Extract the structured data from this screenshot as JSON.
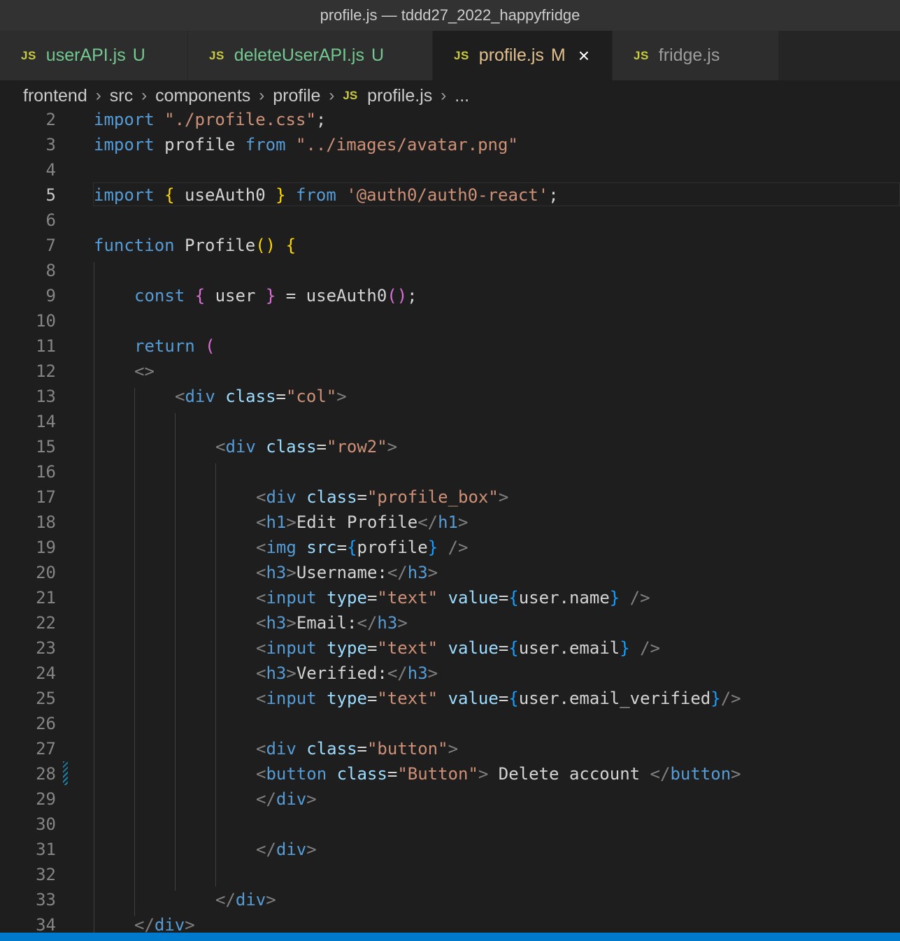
{
  "window": {
    "title": "profile.js — tddd27_2022_happyfridge"
  },
  "tabs": [
    {
      "icon": "JS",
      "name": "userAPI.js",
      "flag": "U"
    },
    {
      "icon": "JS",
      "name": "deleteUserAPI.js",
      "flag": "U"
    },
    {
      "icon": "JS",
      "name": "profile.js",
      "flag": "M",
      "close": "×"
    },
    {
      "icon": "JS",
      "name": "fridge.js",
      "flag": ""
    }
  ],
  "breadcrumb": {
    "items": [
      "frontend",
      "src",
      "components",
      "profile"
    ],
    "file_icon": "JS",
    "file": "profile.js",
    "more": "..."
  },
  "editor": {
    "line_numbers": [
      "2",
      "3",
      "4",
      "5",
      "6",
      "7",
      "8",
      "9",
      "10",
      "11",
      "12",
      "13",
      "14",
      "15",
      "16",
      "17",
      "18",
      "19",
      "20",
      "21",
      "22",
      "23",
      "24",
      "25",
      "26",
      "27",
      "28",
      "29",
      "30",
      "31",
      "32",
      "33",
      "34"
    ],
    "current_line": "5",
    "lines": {
      "l2": [
        "import",
        " ",
        "\"./profile.css\"",
        ";"
      ],
      "l3": [
        "import",
        " profile ",
        "from",
        " ",
        "\"../images/avatar.png\""
      ],
      "l5": [
        "import",
        " ",
        "{",
        " useAuth0 ",
        "}",
        " ",
        "from",
        " ",
        "'@auth0/auth0-react'",
        ";"
      ],
      "l7": [
        "function",
        " ",
        "Profile",
        "()",
        " ",
        "{"
      ],
      "l9": [
        "const",
        " ",
        "{",
        " user ",
        "}",
        " = ",
        "useAuth0",
        "()",
        ";"
      ],
      "l11": [
        "return",
        " ",
        "("
      ],
      "l12": [
        "<>"
      ],
      "l13": [
        "<",
        "div",
        " ",
        "class",
        "=",
        "\"col\"",
        ">"
      ],
      "l15": [
        "<",
        "div",
        " ",
        "class",
        "=",
        "\"row2\"",
        ">"
      ],
      "l17": [
        "<",
        "div",
        " ",
        "class",
        "=",
        "\"profile_box\"",
        ">"
      ],
      "l18": [
        "<",
        "h1",
        ">",
        "Edit Profile",
        "</",
        "h1",
        ">"
      ],
      "l19": [
        "<",
        "img",
        " ",
        "src",
        "=",
        "{",
        "profile",
        "}",
        " />"
      ],
      "l20": [
        "<",
        "h3",
        ">",
        "Username:",
        "</",
        "h3",
        ">"
      ],
      "l21": [
        "<",
        "input",
        " ",
        "type",
        "=",
        "\"text\"",
        " ",
        "value",
        "=",
        "{",
        "user.name",
        "}",
        " />"
      ],
      "l22": [
        "<",
        "h3",
        ">",
        "Email:",
        "</",
        "h3",
        ">"
      ],
      "l23": [
        "<",
        "input",
        " ",
        "type",
        "=",
        "\"text\"",
        " ",
        "value",
        "=",
        "{",
        "user.email",
        "}",
        " />"
      ],
      "l24": [
        "<",
        "h3",
        ">",
        "Verified:",
        "</",
        "h3",
        ">"
      ],
      "l25": [
        "<",
        "input",
        " ",
        "type",
        "=",
        "\"text\"",
        " ",
        "value",
        "=",
        "{",
        "user.email_verified",
        "}",
        "/>"
      ],
      "l27": [
        "<",
        "div",
        " ",
        "class",
        "=",
        "\"button\"",
        ">"
      ],
      "l28": [
        "<",
        "button",
        " ",
        "class",
        "=",
        "\"Button\"",
        ">",
        " Delete account ",
        "</",
        "button",
        ">"
      ],
      "l29": [
        "</",
        "div",
        ">"
      ],
      "l31": [
        "</",
        "div",
        ">"
      ],
      "l33": [
        "</",
        "div",
        ">"
      ],
      "l34": [
        "</",
        "div",
        ">"
      ]
    }
  },
  "theme": {
    "background": "#1e1e1e",
    "accent_statusbar": "#007acc",
    "keyword": "#569cd6",
    "string": "#ce9178",
    "attribute": "#9cdcfe"
  }
}
